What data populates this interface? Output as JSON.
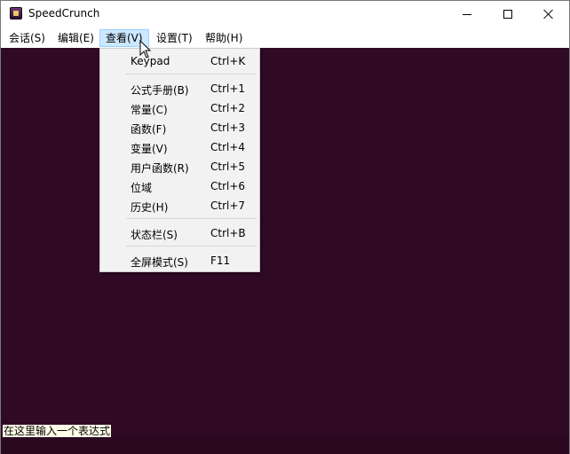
{
  "window": {
    "title": "SpeedCrunch"
  },
  "titlebar_icons": {
    "app": "speedcrunch-app-icon",
    "minimize": "minimize-icon",
    "maximize": "maximize-icon",
    "close": "close-icon"
  },
  "menubar": {
    "items": [
      {
        "label": "会话(S)"
      },
      {
        "label": "编辑(E)"
      },
      {
        "label": "查看(V)"
      },
      {
        "label": "设置(T)"
      },
      {
        "label": "帮助(H)"
      }
    ],
    "active_index": 2
  },
  "view_menu": {
    "items": [
      {
        "label": "Keypad",
        "shortcut": "Ctrl+K"
      },
      {
        "label": "公式手册(B)",
        "shortcut": "Ctrl+1"
      },
      {
        "label": "常量(C)",
        "shortcut": "Ctrl+2"
      },
      {
        "label": "函数(F)",
        "shortcut": "Ctrl+3"
      },
      {
        "label": "变量(V)",
        "shortcut": "Ctrl+4"
      },
      {
        "label": "用户函数(R)",
        "shortcut": "Ctrl+5"
      },
      {
        "label": "位域",
        "shortcut": "Ctrl+6"
      },
      {
        "label": "历史(H)",
        "shortcut": "Ctrl+7"
      },
      {
        "label": "状态栏(S)",
        "shortcut": "Ctrl+B"
      },
      {
        "label": "全屏模式(S)",
        "shortcut": "F11"
      }
    ]
  },
  "editor": {
    "placeholder": "在这里输入一个表达式"
  },
  "colors": {
    "workspace_bg": "#300a24",
    "menu_highlight": "#cce8ff",
    "dropdown_bg": "#f2f2f2"
  }
}
